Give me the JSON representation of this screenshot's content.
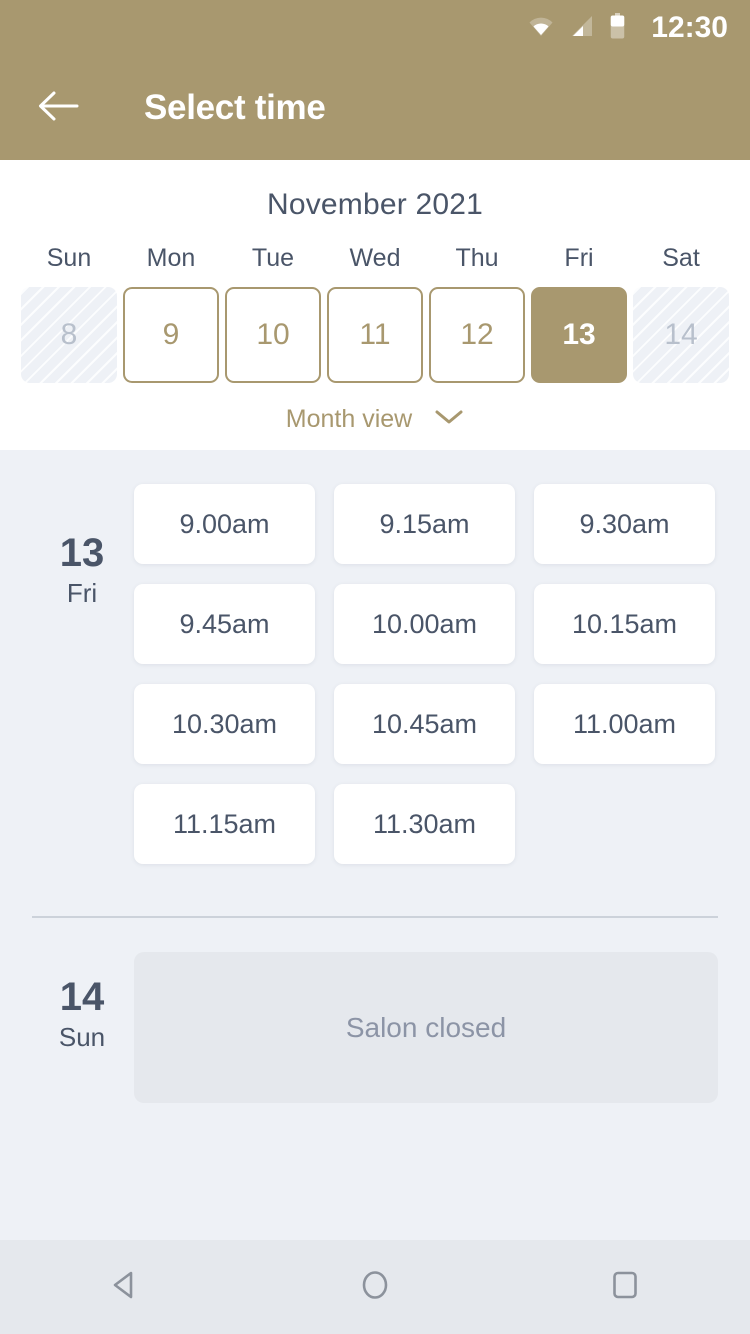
{
  "status_bar": {
    "time": "12:30",
    "icons": [
      "wifi-icon",
      "cell-signal-icon",
      "battery-icon"
    ]
  },
  "app_bar": {
    "back_icon": "back-arrow-icon",
    "title": "Select time"
  },
  "calendar": {
    "month_title": "November 2021",
    "weekdays": [
      "Sun",
      "Mon",
      "Tue",
      "Wed",
      "Thu",
      "Fri",
      "Sat"
    ],
    "days": [
      {
        "num": "8",
        "state": "disabled"
      },
      {
        "num": "9",
        "state": "available"
      },
      {
        "num": "10",
        "state": "available"
      },
      {
        "num": "11",
        "state": "available"
      },
      {
        "num": "12",
        "state": "available"
      },
      {
        "num": "13",
        "state": "selected"
      },
      {
        "num": "14",
        "state": "disabled"
      }
    ],
    "view_toggle": {
      "label": "Month view",
      "icon": "chevron-down-icon"
    }
  },
  "schedule": [
    {
      "day_num": "13",
      "day_of_week": "Fri",
      "slots": [
        "9.00am",
        "9.15am",
        "9.30am",
        "9.45am",
        "10.00am",
        "10.15am",
        "10.30am",
        "10.45am",
        "11.00am",
        "11.15am",
        "11.30am"
      ]
    },
    {
      "day_num": "14",
      "day_of_week": "Sun",
      "closed_message": "Salon closed"
    }
  ],
  "nav_bar": {
    "back": "nav-back-icon",
    "home": "nav-home-icon",
    "recents": "nav-recents-icon"
  },
  "colors": {
    "brand": "#a8986f",
    "surface": "#eef1f6",
    "text_dark": "#4a5568",
    "text_muted": "#8c94a6",
    "closed_bg": "#e5e8ed",
    "divider": "#ccd2da"
  }
}
